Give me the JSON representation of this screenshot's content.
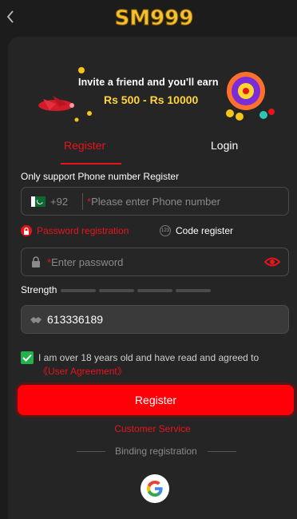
{
  "header": {
    "logo_text": "SM999"
  },
  "banner": {
    "line1": "Invite a friend and you'll earn",
    "line2": "Rs 500 - Rs 10000"
  },
  "tabs": [
    {
      "label": "Register",
      "active": true
    },
    {
      "label": "Login",
      "active": false
    }
  ],
  "form": {
    "phone_support_label": "Only support Phone number Register",
    "country_code": "+92",
    "phone_required_mark": "*",
    "phone_placeholder": "Please enter Phone number",
    "option_password": "Password registration",
    "option_code": "Code register",
    "code_badge": "123",
    "password_required_mark": "*",
    "password_placeholder": "Enter password",
    "strength_label": "Strength",
    "invite_code": "613336189",
    "agree_text": "I am over 18 years old and have read and agreed to ",
    "agree_link": "《User Agreement》",
    "agree_checked": true,
    "register_button": "Register",
    "customer_service": "Customer Service",
    "binding_label": "Binding registration"
  },
  "colors": {
    "accent": "#e8141b",
    "button": "#ff0009",
    "checkbox": "#22b14c",
    "logo": "#f2c230"
  }
}
